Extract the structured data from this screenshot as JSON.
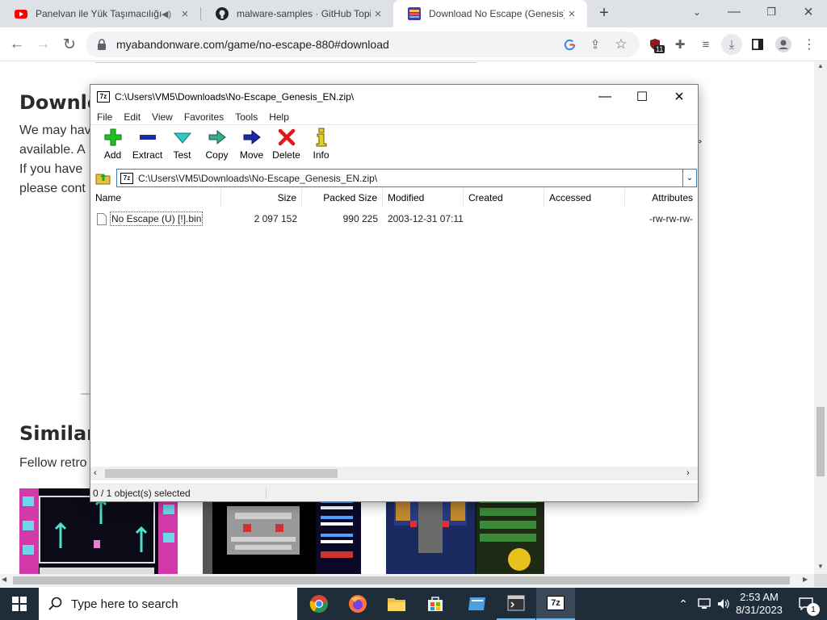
{
  "browser": {
    "tabs": [
      {
        "title": "Panelvan ile Yük Taşımacılığı",
        "icon": "youtube-icon",
        "active": false
      },
      {
        "title": "malware-samples · GitHub Topics",
        "icon": "github-icon",
        "active": false
      },
      {
        "title": "Download No Escape (Genesis) -",
        "icon": "myabandonware-icon",
        "active": true
      }
    ],
    "new_tab_label": "+",
    "url": "myabandonware.com/game/no-escape-880#download",
    "extension_badge": "11"
  },
  "page": {
    "download_heading": "Downlo",
    "download_lines": [
      "We may hav",
      "available. A",
      "If you have",
      "please cont"
    ],
    "similar_heading": "Similar g",
    "similar_text": "Fellow retro"
  },
  "zip": {
    "title": "C:\\Users\\VM5\\Downloads\\No-Escape_Genesis_EN.zip\\",
    "menu": [
      "File",
      "Edit",
      "View",
      "Favorites",
      "Tools",
      "Help"
    ],
    "tools": [
      {
        "label": "Add",
        "icon": "add-icon"
      },
      {
        "label": "Extract",
        "icon": "extract-icon"
      },
      {
        "label": "Test",
        "icon": "test-icon"
      },
      {
        "label": "Copy",
        "icon": "copy-icon"
      },
      {
        "label": "Move",
        "icon": "move-icon"
      },
      {
        "label": "Delete",
        "icon": "delete-icon"
      },
      {
        "label": "Info",
        "icon": "info-icon"
      }
    ],
    "path": "C:\\Users\\VM5\\Downloads\\No-Escape_Genesis_EN.zip\\",
    "columns": [
      "Name",
      "Size",
      "Packed Size",
      "Modified",
      "Created",
      "Accessed",
      "Attributes"
    ],
    "rows": [
      {
        "name": "No Escape (U) [!].bin",
        "size": "2 097 152",
        "packed": "990 225",
        "modified": "2003-12-31 07:11",
        "created": "",
        "accessed": "",
        "attributes": "-rw-rw-rw-"
      }
    ],
    "status": "0 / 1 object(s) selected"
  },
  "taskbar": {
    "search_placeholder": "Type here to search",
    "time": "2:53 AM",
    "date": "8/31/2023",
    "notification_count": "1"
  }
}
